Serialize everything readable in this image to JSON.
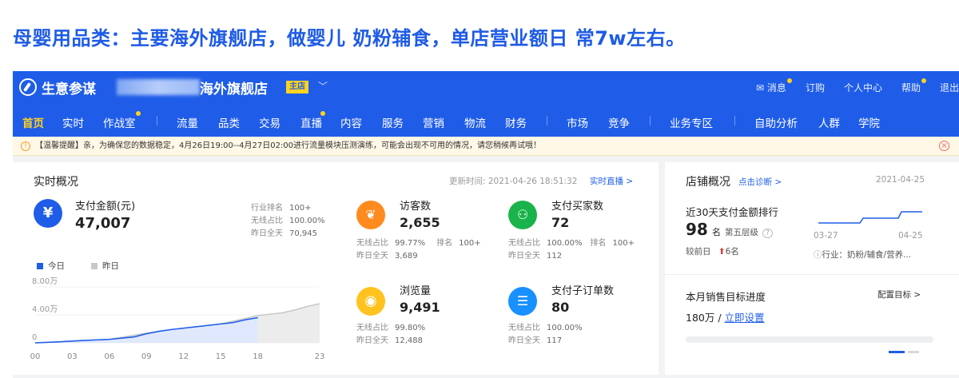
{
  "headline": "母婴用品类：主要海外旗舰店，做婴儿 奶粉辅食，单店营业额日 常7w左右。",
  "topbar": {
    "brand": "生意参谋",
    "store_name": "海外旗舰店",
    "store_badge": "主店",
    "links": [
      "消息",
      "订购",
      "个人中心",
      "帮助",
      "退出"
    ]
  },
  "nav": {
    "items": [
      "首页",
      "实时",
      "作战室",
      "流量",
      "品类",
      "交易",
      "直播",
      "内容",
      "服务",
      "营销",
      "物流",
      "财务",
      "市场",
      "竞争",
      "业务专区",
      "自助分析",
      "人群",
      "学院"
    ],
    "active": "首页"
  },
  "notice": "【温馨提醒】亲，为确保您的数据稳定，4月26日19:00--4月27日02:00进行流量模块压测演练，可能会出现不可用的情况，请您稍候再试哦！",
  "realtime": {
    "title": "实时概况",
    "updated_label": "更新时间: 2021-04-26 18:51:32",
    "live_link": "实时直播 >",
    "pay_amount": {
      "icon": "yen-icon",
      "label": "支付金额(元)",
      "value": "47,007",
      "rank_label": "行业排名",
      "rank_value": "100+",
      "wireless_label": "无线占比",
      "wireless_value": "100.00%",
      "yesterday_label": "昨日全天",
      "yesterday_value": "70,945"
    },
    "visitors": {
      "label": "访客数",
      "value": "2,655",
      "wireless_label": "无线占比",
      "wireless_value": "99.77%",
      "rank_label": "排名",
      "rank_value": "100+",
      "yesterday_label": "昨日全天",
      "yesterday_value": "3,689"
    },
    "buyers": {
      "label": "支付买家数",
      "value": "72",
      "wireless_label": "无线占比",
      "wireless_value": "100.00%",
      "rank_label": "排名",
      "rank_value": "100+",
      "yesterday_label": "昨日全天",
      "yesterday_value": "112"
    },
    "pageviews": {
      "label": "浏览量",
      "value": "9,491",
      "wireless_label": "无线占比",
      "wireless_value": "99.80%",
      "yesterday_label": "昨日全天",
      "yesterday_value": "12,488"
    },
    "suborders": {
      "label": "支付子订单数",
      "value": "80",
      "wireless_label": "无线占比",
      "wireless_value": "100.00%",
      "yesterday_label": "昨日全天",
      "yesterday_value": "117"
    },
    "legend": [
      "今日",
      "昨日"
    ],
    "colors": {
      "today": "#1f5de8",
      "yesterday": "#c8c8c8",
      "orange": "#ff8a1e",
      "green": "#19b34b",
      "yellow": "#ffc21e",
      "blue": "#1890ff"
    }
  },
  "chart_data": {
    "type": "area",
    "x": [
      "00",
      "03",
      "06",
      "09",
      "12",
      "15",
      "18",
      "23"
    ],
    "y_ticks": [
      "8.00万",
      "4.00万",
      "0"
    ],
    "ylim": [
      0,
      80000
    ],
    "series": [
      {
        "name": "今日",
        "x": [
          0,
          2,
          4,
          6,
          8,
          9,
          10,
          11,
          12,
          13,
          14,
          15,
          16,
          17,
          18
        ],
        "values": [
          0,
          1500,
          3500,
          5000,
          8500,
          13000,
          16500,
          19000,
          21000,
          23000,
          25000,
          27000,
          29000,
          33000,
          36000
        ]
      },
      {
        "name": "昨日",
        "x": [
          0,
          3,
          6,
          9,
          12,
          15,
          18,
          20,
          21,
          22,
          23
        ],
        "values": [
          0,
          2000,
          5000,
          14000,
          21000,
          27000,
          39000,
          43000,
          47000,
          52000,
          56000
        ]
      }
    ]
  },
  "shop": {
    "title": "店铺概况",
    "diagnose_link": "点击诊断 >",
    "date": "2021-04-25",
    "rank_title": "近30天支付金额排行",
    "rank_value": "98",
    "rank_unit": "名",
    "rank_level": "第五层级",
    "compare_label": "较前日",
    "compare_value": "6名",
    "spark_start": "03-27",
    "spark_end": "04-25",
    "industry": "行业：奶粉/辅食/营养...",
    "target_title": "本月销售目标进度",
    "target_link": "配置目标 >",
    "target_value": "180万",
    "target_set": "立即设置",
    "target_progress": 0
  }
}
